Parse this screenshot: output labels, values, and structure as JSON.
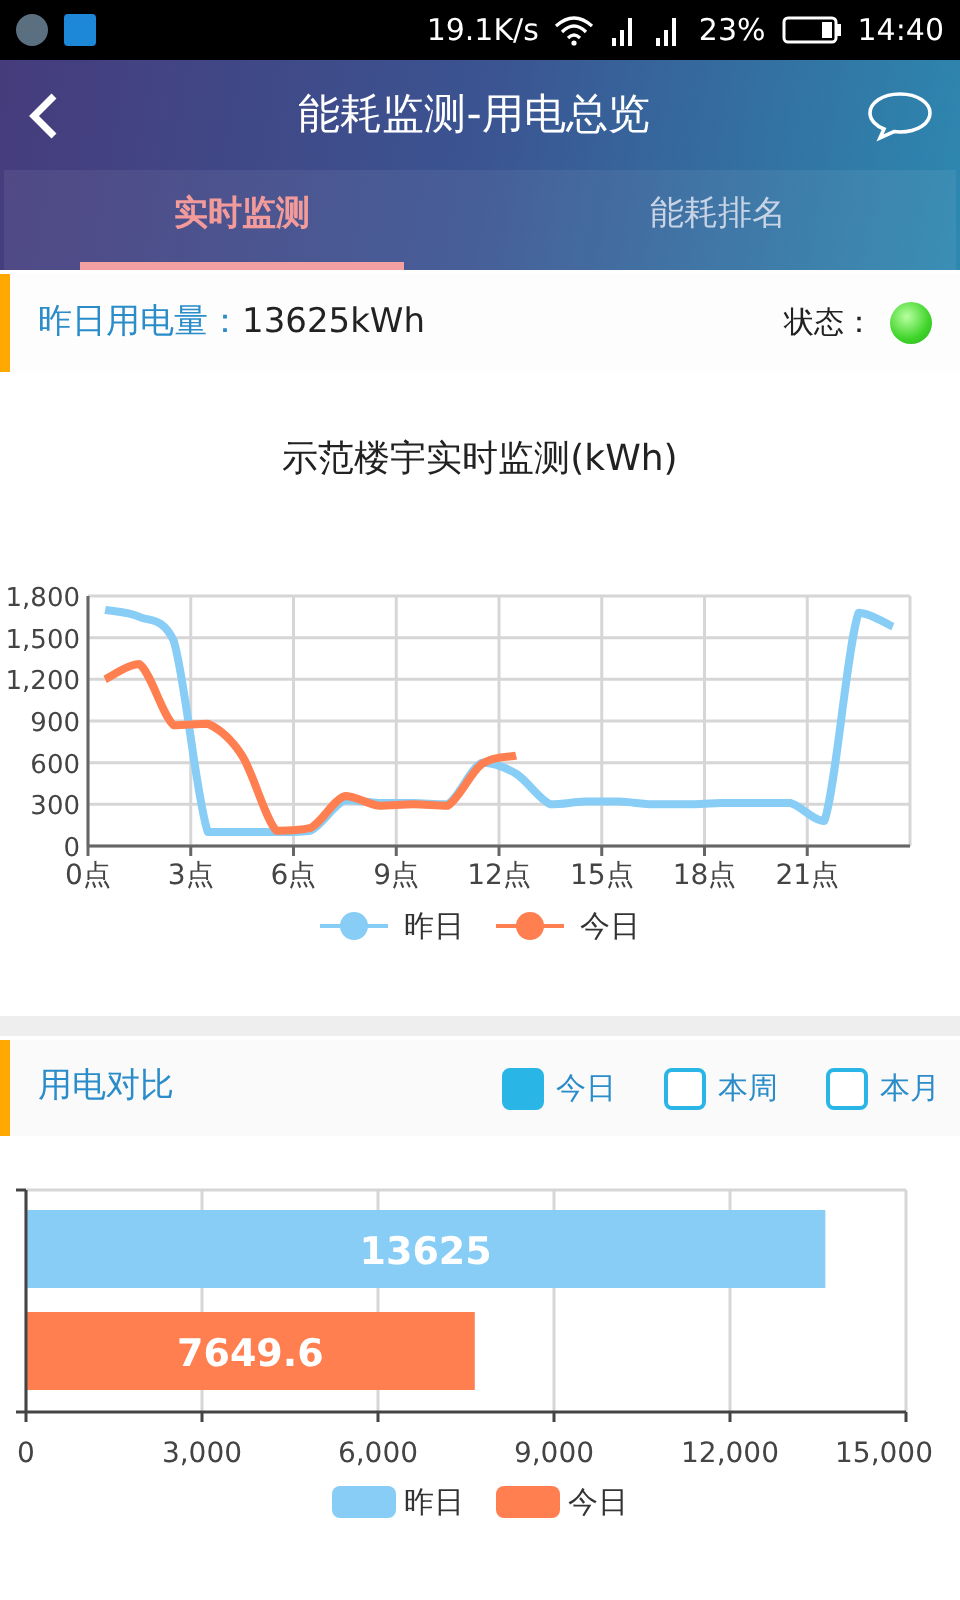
{
  "status_bar": {
    "speed": "19.1K/s",
    "battery": "23%",
    "time": "14:40"
  },
  "header": {
    "title": "能耗监测-用电总览"
  },
  "tabs": [
    {
      "label": "实时监测",
      "selected": true
    },
    {
      "label": "能耗排名",
      "selected": false
    }
  ],
  "summary": {
    "label": "昨日用电量：",
    "value": "13625kWh",
    "status_label": "状态：",
    "status_ok": true
  },
  "line_chart": {
    "chart_data": {
      "type": "line",
      "title": "示范楼宇实时监测(kWh)",
      "grid": true,
      "xlim": [
        0,
        24
      ],
      "ylim": [
        0,
        1800
      ],
      "x": [
        0.5,
        1.5,
        2.5,
        3.5,
        4.5,
        5.5,
        6.5,
        7.5,
        8.5,
        9.5,
        10.5,
        11.5,
        12.5,
        13.5,
        14.5,
        15.5,
        16.5,
        17.5,
        18.5,
        19.5,
        20.5,
        21.5,
        22.5,
        23.5
      ],
      "xticks": [
        {
          "value": 0,
          "label": "0点"
        },
        {
          "value": 3,
          "label": "3点"
        },
        {
          "value": 6,
          "label": "6点"
        },
        {
          "value": 9,
          "label": "9点"
        },
        {
          "value": 12,
          "label": "12点"
        },
        {
          "value": 15,
          "label": "15点"
        },
        {
          "value": 18,
          "label": "18点"
        },
        {
          "value": 21,
          "label": "21点"
        }
      ],
      "yticks": [
        0,
        300,
        600,
        900,
        {
          "value": 1200,
          "label": "1,200"
        },
        {
          "value": 1500,
          "label": "1,500"
        },
        {
          "value": 1800,
          "label": "1,800"
        }
      ],
      "series": [
        {
          "name": "昨日",
          "color": "#88cdf6",
          "values": [
            1700,
            1650,
            1480,
            100,
            100,
            100,
            110,
            330,
            310,
            310,
            300,
            600,
            520,
            300,
            320,
            320,
            300,
            300,
            310,
            310,
            310,
            180,
            1680,
            1580
          ]
        },
        {
          "name": "今日",
          "color": "#ff7f50",
          "values": [
            1200,
            1310,
            870,
            880,
            650,
            110,
            130,
            360,
            290,
            300,
            290,
            590,
            650,
            null,
            null,
            null,
            null,
            null,
            null,
            null,
            null,
            null,
            null,
            null
          ]
        }
      ]
    }
  },
  "comparison": {
    "title": "用电对比",
    "options": [
      {
        "label": "今日",
        "selected": true
      },
      {
        "label": "本周",
        "selected": false
      },
      {
        "label": "本月",
        "selected": false
      }
    ],
    "chart_data": {
      "type": "bar",
      "orientation": "horizontal",
      "grid": true,
      "xlim": [
        0,
        15000
      ],
      "xticks": [
        0,
        {
          "value": 3000,
          "label": "3,000"
        },
        {
          "value": 6000,
          "label": "6,000"
        },
        {
          "value": 9000,
          "label": "9,000"
        },
        {
          "value": 12000,
          "label": "12,000"
        },
        {
          "value": 15000,
          "label": "15,000"
        }
      ],
      "series": [
        {
          "name": "昨日",
          "color": "#88cdf6",
          "values": [
            13625
          ]
        },
        {
          "name": "今日",
          "color": "#ff7f50",
          "values": [
            7649.6
          ]
        }
      ],
      "data_labels": true
    }
  }
}
